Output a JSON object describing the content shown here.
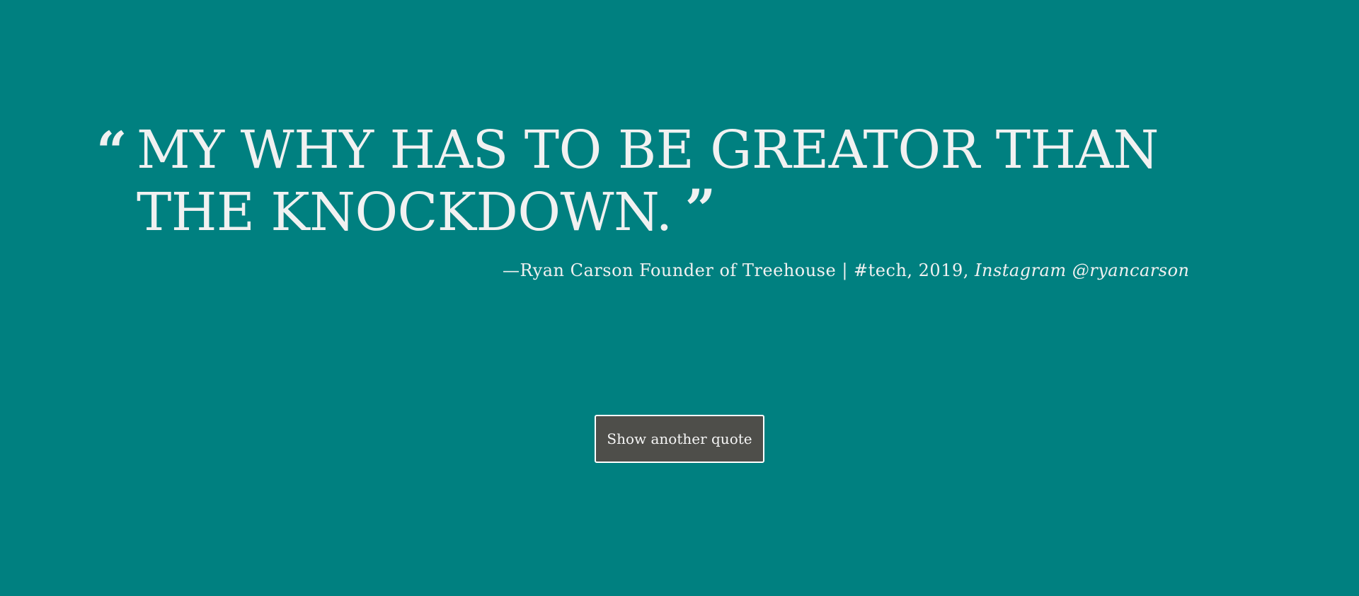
{
  "colors": {
    "background": "#008080",
    "text": "#f1f1f1",
    "button_background": "#4e4e4a",
    "button_border": "#ffffff"
  },
  "quote": {
    "open_mark": "“",
    "text": "MY WHY HAS TO BE GREATOR THAN THE KNOCKDOWN.",
    "close_mark": "”"
  },
  "attribution": {
    "main": "—Ryan Carson Founder of Treehouse | #tech, 2019, ",
    "source": "Instagram @ryancarson"
  },
  "button": {
    "label": "Show another quote"
  }
}
